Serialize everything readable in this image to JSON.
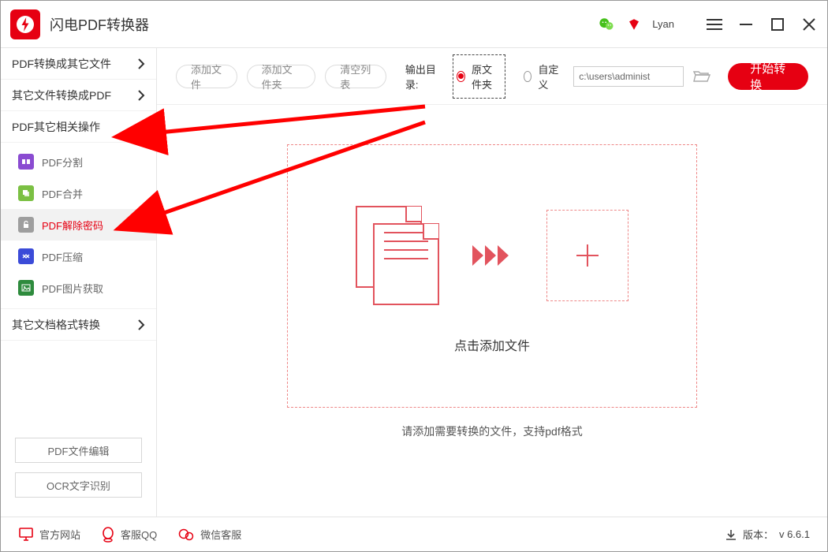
{
  "app": {
    "title": "闪电PDF转换器"
  },
  "user": {
    "name": "Lyan"
  },
  "sidebar": {
    "groups": {
      "to_other": {
        "label": "PDF转换成其它文件"
      },
      "from_other": {
        "label": "其它文件转换成PDF"
      },
      "pdf_ops": {
        "label": "PDF其它相关操作"
      },
      "doc_conv": {
        "label": "其它文档格式转换"
      }
    },
    "pdf_ops_items": [
      {
        "id": "split",
        "label": "PDF分割",
        "icon_color": "#8a4bd1"
      },
      {
        "id": "merge",
        "label": "PDF合并",
        "icon_color": "#7bc043"
      },
      {
        "id": "decrypt",
        "label": "PDF解除密码",
        "icon_color": "#9e9e9e",
        "active": true
      },
      {
        "id": "compress",
        "label": "PDF压缩",
        "icon_color": "#3b4bd8"
      },
      {
        "id": "images",
        "label": "PDF图片获取",
        "icon_color": "#2e8b3d"
      }
    ],
    "bottom_buttons": {
      "edit": "PDF文件编辑",
      "ocr": "OCR文字识别"
    }
  },
  "toolbar": {
    "add_file": "添加文件",
    "add_folder": "添加文件夹",
    "clear_list": "清空列表",
    "output_label": "输出目录:",
    "radio_source": "原文件夹",
    "radio_custom": "自定义",
    "path": "c:\\users\\administ",
    "start": "开始转换"
  },
  "dropzone": {
    "click_text": "点击添加文件",
    "hint_text": "请添加需要转换的文件，支持pdf格式"
  },
  "footer": {
    "website": "官方网站",
    "qq": "客服QQ",
    "wechat": "微信客服",
    "version_label": "版本：",
    "version_value": "v 6.6.1"
  }
}
